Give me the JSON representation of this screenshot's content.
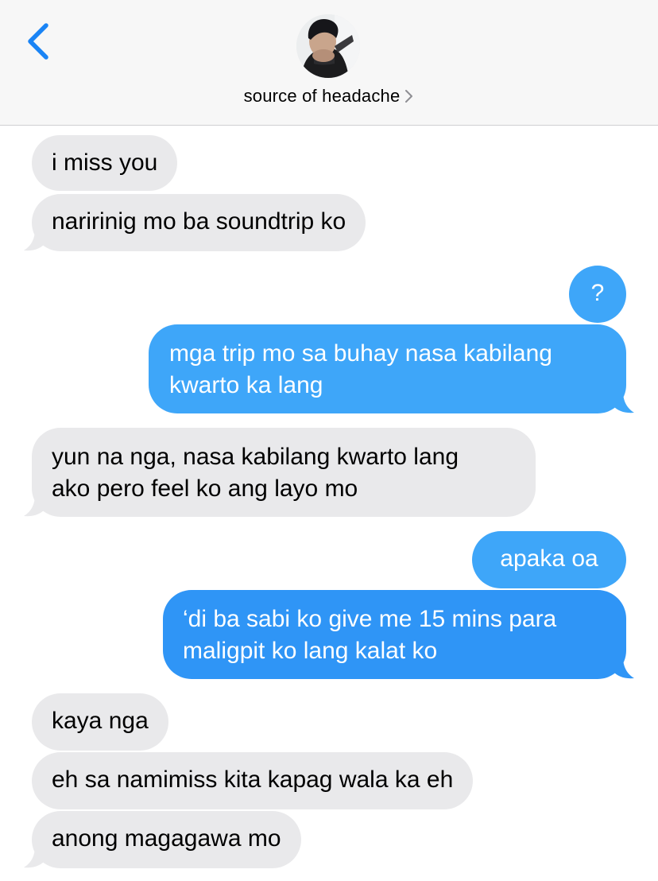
{
  "header": {
    "contact_name": "source of headache",
    "back_icon": "chevron-left-icon",
    "detail_icon": "chevron-right-icon"
  },
  "messages": [
    {
      "from": "them",
      "text": "i miss you"
    },
    {
      "from": "them",
      "text": "naririnig mo ba soundtrip ko"
    },
    {
      "from": "me",
      "text": "?"
    },
    {
      "from": "me",
      "lines": [
        "mga trip mo sa buhay nasa kabilang",
        "kwarto ka lang"
      ]
    },
    {
      "from": "them",
      "lines": [
        "yun na nga, nasa kabilang kwarto lang",
        "ako pero feel ko ang layo mo"
      ]
    },
    {
      "from": "me",
      "text": "apaka oa"
    },
    {
      "from": "me",
      "lines": [
        "‘di ba sabi ko give me 15 mins para",
        "maligpit ko lang kalat ko"
      ]
    },
    {
      "from": "them",
      "text": "kaya nga"
    },
    {
      "from": "them",
      "text": "eh sa namimiss kita kapag wala ka eh"
    },
    {
      "from": "them",
      "text": "anong magagawa mo"
    }
  ],
  "colors": {
    "accent": "#1a84f5",
    "sent_bubble": "#3ea6f9",
    "received_bubble": "#e9e9eb",
    "header_bg": "#f7f7f7"
  }
}
